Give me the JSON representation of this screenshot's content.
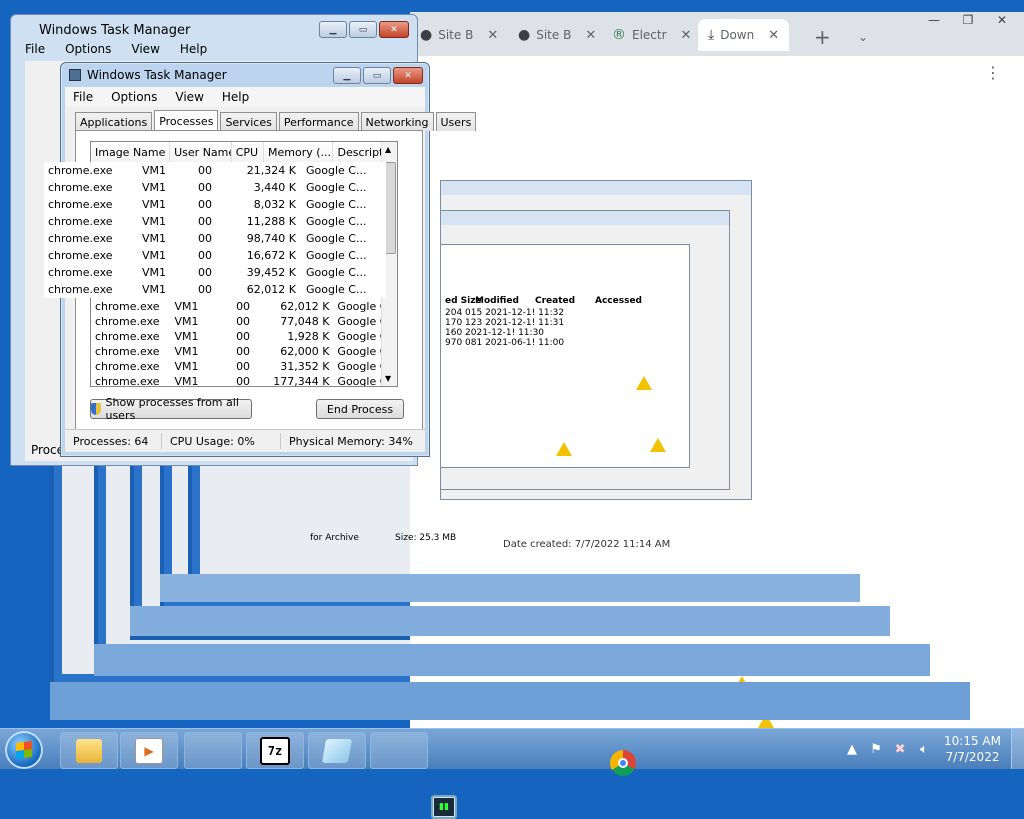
{
  "desktop": {
    "bg_color": "#1565c0"
  },
  "chrome": {
    "tabs": [
      {
        "label": "Site B",
        "icon": "github-icon"
      },
      {
        "label": "Site B",
        "icon": "github-icon"
      },
      {
        "label": "Electr",
        "icon": "app-icon"
      },
      {
        "label": "Down",
        "icon": "download-icon"
      }
    ],
    "new_tab": "+",
    "dropdown": "⌄",
    "kebab": "⋮",
    "win_min": "—",
    "win_max": "❐",
    "win_close": "✕"
  },
  "back_window": {
    "title": "Windows Task Manager",
    "menu": [
      "File",
      "Options",
      "View",
      "Help"
    ],
    "status": "Proce"
  },
  "taskmgr": {
    "title": "Windows Task Manager",
    "menu": [
      "File",
      "Options",
      "View",
      "Help"
    ],
    "tabs": [
      "Applications",
      "Processes",
      "Services",
      "Performance",
      "Networking",
      "Users"
    ],
    "active_tab": "Processes",
    "columns": [
      "Image Name",
      "User Name",
      "CPU",
      "Memory (...",
      "Description"
    ],
    "rows": [
      {
        "name": "chrome.exe",
        "user": "VM1",
        "cpu": "00",
        "mem": "62,012 K",
        "desc": "Google C..."
      },
      {
        "name": "chrome.exe",
        "user": "VM1",
        "cpu": "00",
        "mem": "77,048 K",
        "desc": "Google C..."
      },
      {
        "name": "chrome.exe",
        "user": "VM1",
        "cpu": "00",
        "mem": "1,928 K",
        "desc": "Google C..."
      },
      {
        "name": "chrome.exe",
        "user": "VM1",
        "cpu": "00",
        "mem": "62,000 K",
        "desc": "Google C..."
      },
      {
        "name": "chrome.exe",
        "user": "VM1",
        "cpu": "00",
        "mem": "31,352 K",
        "desc": "Google C..."
      },
      {
        "name": "chrome.exe",
        "user": "VM1",
        "cpu": "00",
        "mem": "177,344 K",
        "desc": "Google C..."
      }
    ],
    "show_all_label": "Show processes from all users",
    "end_process_label": "End Process",
    "status": {
      "processes": "Processes: 64",
      "cpu": "CPU Usage: 0%",
      "memory": "Physical Memory: 34%"
    }
  },
  "ghost_rows": [
    {
      "name": "chrome.exe",
      "user": "VM1",
      "cpu": "00",
      "mem": "21,324 K",
      "desc": "Google C..."
    },
    {
      "name": "chrome.exe",
      "user": "VM1",
      "cpu": "00",
      "mem": "3,440 K",
      "desc": "Google C..."
    },
    {
      "name": "chrome.exe",
      "user": "VM1",
      "cpu": "00",
      "mem": "8,032 K",
      "desc": "Google C..."
    },
    {
      "name": "chrome.exe",
      "user": "VM1",
      "cpu": "00",
      "mem": "11,288 K",
      "desc": "Google C..."
    },
    {
      "name": "chrome.exe",
      "user": "VM1",
      "cpu": "00",
      "mem": "98,740 K",
      "desc": "Google C..."
    },
    {
      "name": "chrome.exe",
      "user": "VM1",
      "cpu": "00",
      "mem": "16,672 K",
      "desc": "Google C..."
    },
    {
      "name": "chrome.exe",
      "user": "VM1",
      "cpu": "00",
      "mem": "39,452 K",
      "desc": "Google C..."
    },
    {
      "name": "chrome.exe",
      "user": "VM1",
      "cpu": "00",
      "mem": "62,012 K",
      "desc": "Google C..."
    }
  ],
  "downloads": {
    "columns": [
      "ed Size",
      "Modified",
      "Created",
      "Accessed"
    ],
    "lines": [
      "204 015   2021-12-1! 11:32",
      "170 123   2021-12-1! 11:31",
      "160   2021-12-1! 11:30",
      "970 081   2021-06-1! 11:00"
    ],
    "date_created": "Date created: 7/7/2022 11:14 AM",
    "archive_label": "for Archive",
    "size_label": "Size: 25.3 MB"
  },
  "taskbar": {
    "apps": [
      {
        "name": "explorer",
        "glyph": ""
      },
      {
        "name": "media-player",
        "glyph": "▶"
      },
      {
        "name": "chrome",
        "glyph": ""
      },
      {
        "name": "7zip",
        "glyph": "7z"
      },
      {
        "name": "notepad",
        "glyph": ""
      },
      {
        "name": "task-manager",
        "glyph": "▮▮"
      }
    ],
    "time": "10:15 AM",
    "date": "7/7/2022"
  }
}
